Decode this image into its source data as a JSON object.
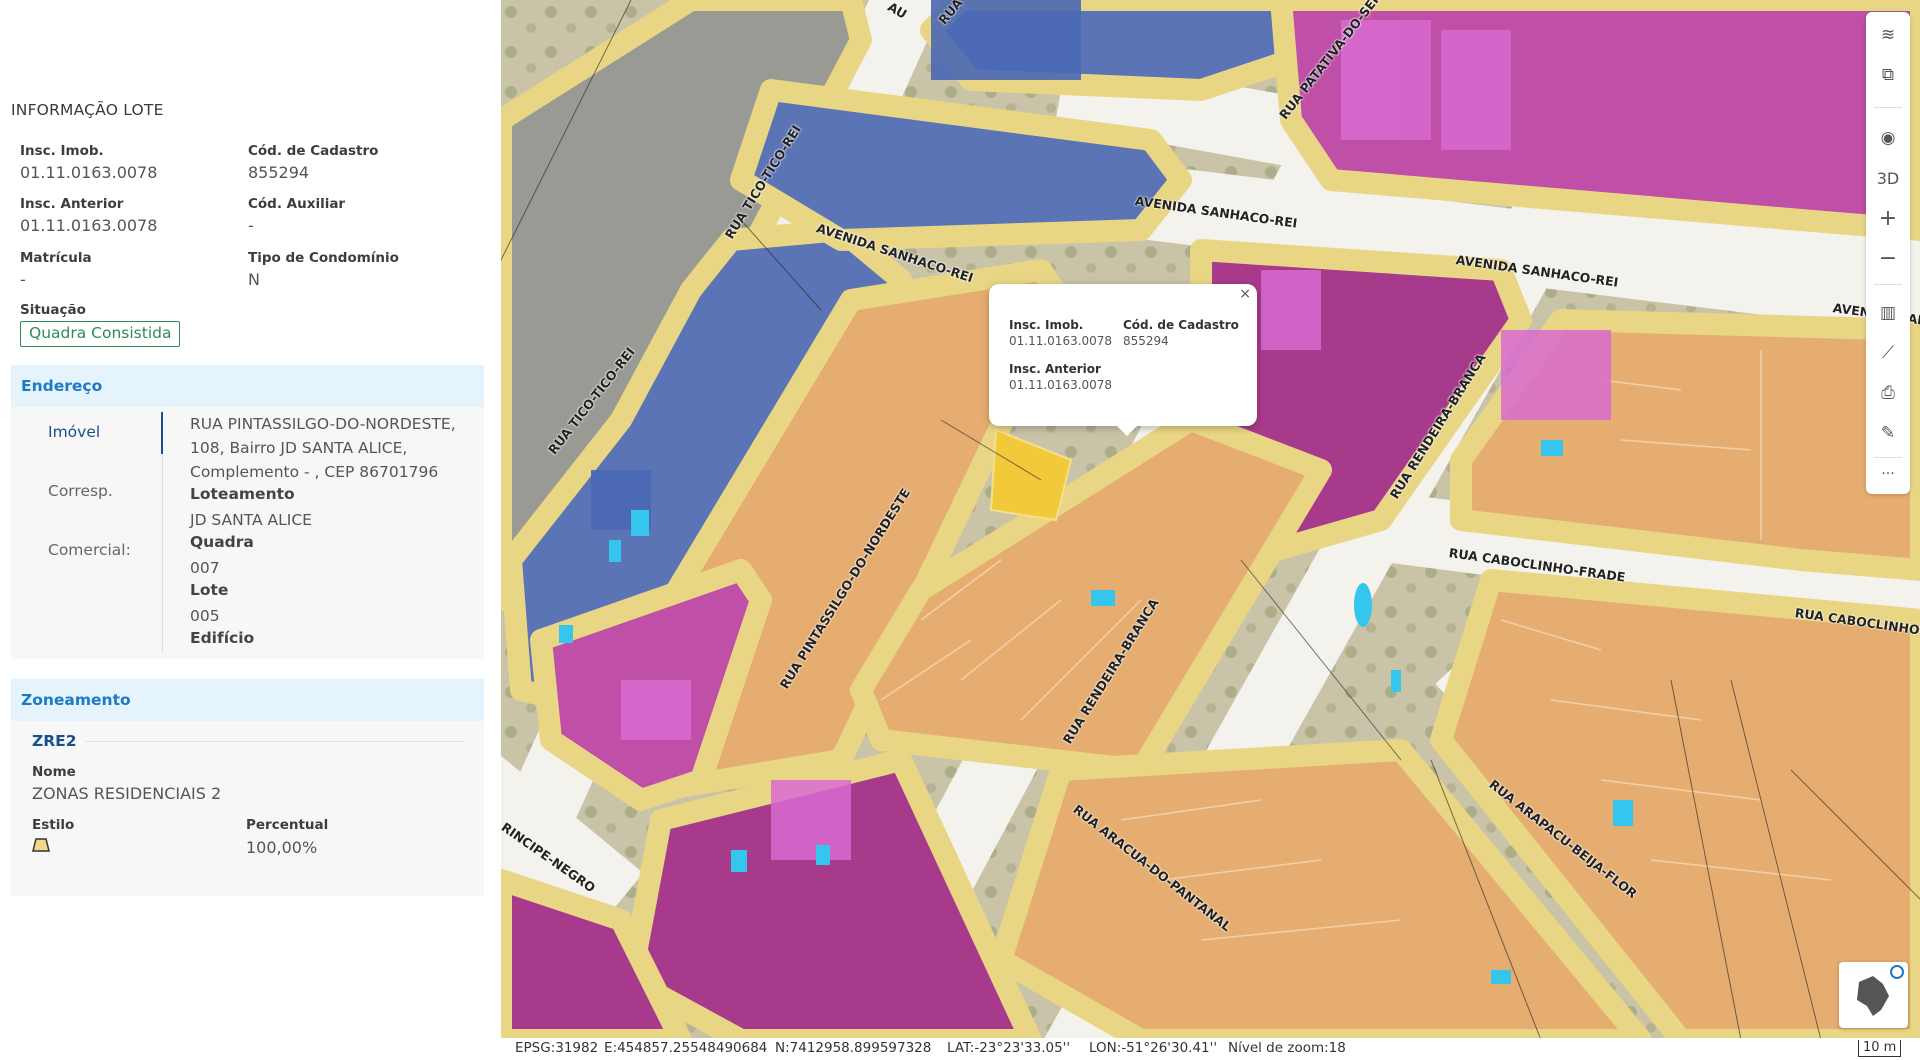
{
  "panel": {
    "title": "INFORMAÇÃO LOTE",
    "fields": {
      "insc_imob_label": "Insc. Imob.",
      "insc_imob_value": "01.11.0163.0078",
      "cod_cadastro_label": "Cód. de Cadastro",
      "cod_cadastro_value": "855294",
      "insc_anterior_label": "Insc. Anterior",
      "insc_anterior_value": "01.11.0163.0078",
      "cod_auxiliar_label": "Cód. Auxiliar",
      "cod_auxiliar_value": "-",
      "matricula_label": "Matrícula",
      "matricula_value": "-",
      "tipo_condominio_label": "Tipo de Condomínio",
      "tipo_condominio_value": "N",
      "situacao_label": "Situação",
      "situacao_value": "Quadra Consistida"
    },
    "endereco": {
      "title": "Endereço",
      "tabs": [
        "Imóvel",
        "Corresp.",
        "Comercial:"
      ],
      "address_lines": [
        "RUA PINTASSILGO-DO-NORDESTE,",
        "108, Bairro JD SANTA ALICE,",
        "Complemento - , CEP 86701796"
      ],
      "loteamento_label": "Loteamento",
      "loteamento_value": "JD SANTA ALICE",
      "quadra_label": "Quadra",
      "quadra_value": "007",
      "lote_label": "Lote",
      "lote_value": "005",
      "edificio_label": "Edifício"
    },
    "zoneamento": {
      "title": "Zoneamento",
      "code": "ZRE2",
      "nome_label": "Nome",
      "nome_value": "ZONAS RESIDENCIAIS 2",
      "estilo_label": "Estilo",
      "percentual_label": "Percentual",
      "percentual_value": "100,00%"
    }
  },
  "map": {
    "streets": [
      "RUA TICO-TICO-REI",
      "AVENIDA SANHACO-REI",
      "AVENIDA SANHACO-REI",
      "AVENIDA SANHACO-REI",
      "AVENIDA SANHACO-REI",
      "RUA PATATIVA-DO-SERTAO",
      "RUA TICO-TICO-REI",
      "RUA PINTASSILGO-DO-NORDESTE",
      "RUA RENDEIRA-BRANCA",
      "RUA CABOCLINHO-FRADE",
      "RUA CABOCLINHO-FRADE",
      "RUA RENDEIRA-BRANCA",
      "RUA ARACUA-DO-PANTANAL",
      "RUA ARAPACU-BEIJA-FLOR",
      "RINCIPE-NEGRO",
      "AU",
      "RUA"
    ],
    "popup": {
      "close": "×",
      "insc_imob_label": "Insc. Imob.",
      "insc_imob_value": "01.11.0163.0078",
      "cod_cadastro_label": "Cód. de Cadastro",
      "cod_cadastro_value": "855294",
      "insc_anterior_label": "Insc. Anterior",
      "insc_anterior_value": "01.11.0163.0078"
    },
    "toolbar": [
      {
        "name": "layers-icon",
        "glyph": "≋"
      },
      {
        "name": "layers-add-icon",
        "glyph": "⧉"
      },
      {
        "name": "compass-icon",
        "glyph": "◉"
      },
      {
        "name": "3d-toggle",
        "glyph": "3D"
      },
      {
        "name": "zoom-in-icon",
        "glyph": "+"
      },
      {
        "name": "zoom-out-icon",
        "glyph": "−"
      },
      {
        "name": "basemap-icon",
        "glyph": "▥"
      },
      {
        "name": "ruler-icon",
        "glyph": "⟋"
      },
      {
        "name": "print-icon",
        "glyph": "⎙"
      },
      {
        "name": "draw-icon",
        "glyph": "✎"
      },
      {
        "name": "more-icon",
        "glyph": "···"
      }
    ]
  },
  "status": {
    "epsg": "EPSG:31982",
    "east": "E:454857.25548490684",
    "north": "N:7412958.899597328",
    "lat": "LAT:-23°23'33.05''",
    "lon": "LON:-51°26'30.41''",
    "zoom": "Nível de zoom:18",
    "scale": "10 m"
  },
  "colors": {
    "accent": "#1f7ac4",
    "section_bg": "#e4f3fc",
    "badge": "#2e8b57",
    "road": "#ead98a",
    "lot_orange": "#e8b77a",
    "lot_magenta": "#c24bb3",
    "lot_blue": "#4f6fb8",
    "selected_lot": "#f2c93a",
    "water_cyan": "#35c6ee"
  }
}
